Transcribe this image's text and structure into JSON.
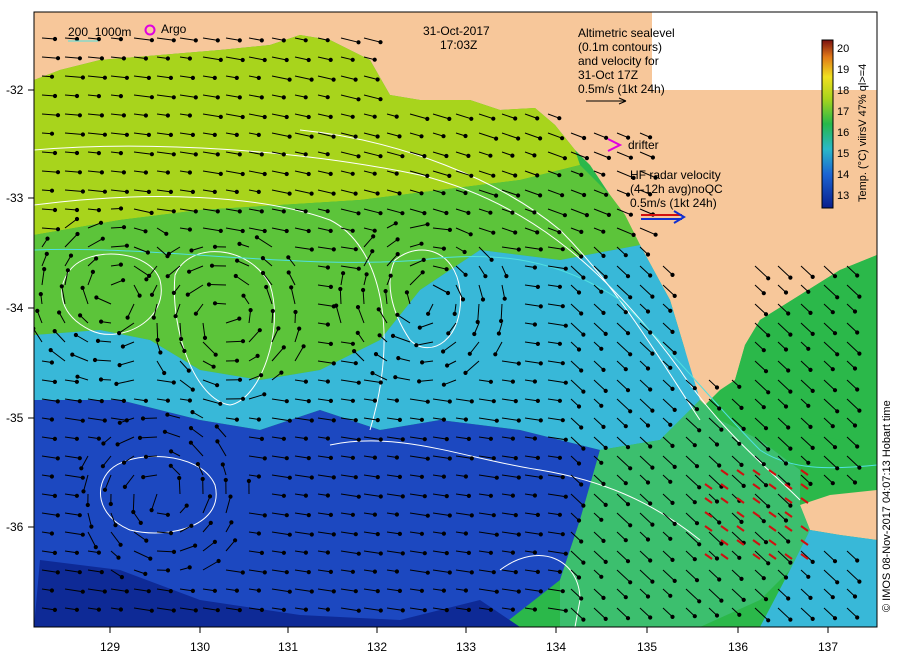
{
  "map": {
    "x_ticks": [
      "129",
      "130",
      "131",
      "132",
      "133",
      "134",
      "135",
      "136",
      "137"
    ],
    "y_ticks": [
      "-32",
      "-33",
      "-34",
      "-35",
      "-36"
    ],
    "date": "31-Oct-2017",
    "time": "17:03Z",
    "bathy_legend": {
      "label1": "200",
      "label2": "1000m"
    },
    "argo_label": "Argo",
    "altimetry_text": [
      "Altimetric sealevel",
      "(0.1m contours)",
      "and velocity for",
      "31-Oct 17Z",
      "0.5m/s (1kt 24h)"
    ],
    "drifter_label": "drifter",
    "hf_radar_text": [
      "HF radar velocity",
      "(4-12h avg)noQC",
      "0.5m/s (1kt 24h)"
    ],
    "colorbar": {
      "ticks": [
        "20",
        "19",
        "18",
        "17",
        "16",
        "15",
        "14",
        "13"
      ],
      "label": "Temp. (°C) viirsV 47% ql>=4"
    },
    "credit": "© IMOS 08-Nov-2017 04:07:13 Hobart time",
    "colors": {
      "land": "#f7c79a",
      "ocean_warm": "#9fd21f",
      "ocean_mid": "#2bb84a",
      "ocean_cool": "#38b8d8",
      "ocean_cold": "#1a3fb0",
      "contour": "#ffffff",
      "argo": "#e000e0",
      "hf_radar": "#d01010"
    }
  }
}
